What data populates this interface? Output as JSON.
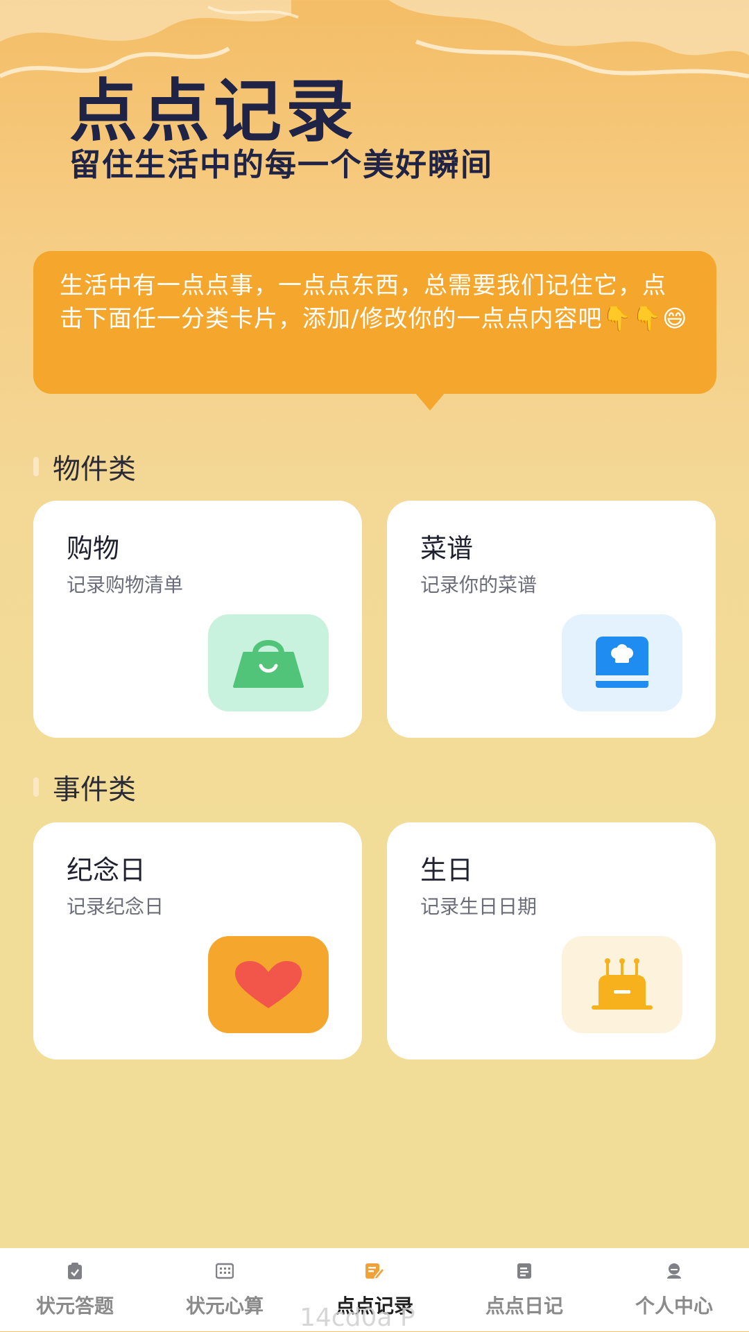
{
  "header": {
    "title": "点点记录",
    "subtitle": "留住生活中的每一个美好瞬间"
  },
  "bubble": {
    "text": "生活中有一点点事，一点点东西，总需要我们记住它，点击下面任一分类卡片，添加/修改你的一点点内容吧👇👇😄"
  },
  "sections": [
    {
      "title": "物件类",
      "cards": [
        {
          "title": "购物",
          "desc": "记录购物清单",
          "icon": "shopping-bag-icon",
          "icon_bg": "#c9f2de",
          "icon_color": "#52c47a"
        },
        {
          "title": "菜谱",
          "desc": "记录你的菜谱",
          "icon": "recipe-book-icon",
          "icon_bg": "#e3f2fd",
          "icon_color": "#1e8cf0"
        }
      ]
    },
    {
      "title": "事件类",
      "cards": [
        {
          "title": "纪念日",
          "desc": "记录纪念日",
          "icon": "heart-icon",
          "icon_bg": "#f4a72c",
          "icon_color": "#f2554a"
        },
        {
          "title": "生日",
          "desc": "记录生日日期",
          "icon": "birthday-cake-icon",
          "icon_bg": "#fdf2dc",
          "icon_color": "#f6b11c"
        }
      ]
    }
  ],
  "tabbar": {
    "items": [
      {
        "label": "状元答题",
        "icon": "clipboard-check-icon",
        "active": false
      },
      {
        "label": "状元心算",
        "icon": "calculator-icon",
        "active": false
      },
      {
        "label": "点点记录",
        "icon": "edit-note-icon",
        "active": true
      },
      {
        "label": "点点日记",
        "icon": "diary-icon",
        "active": false
      },
      {
        "label": "个人中心",
        "icon": "user-icon",
        "active": false
      }
    ]
  },
  "watermark": "14cd0a P",
  "colors": {
    "accent": "#f4a72c",
    "title_navy": "#1f2447",
    "background": "#f2dd98",
    "tab_active_icon": "#f0a13a"
  }
}
